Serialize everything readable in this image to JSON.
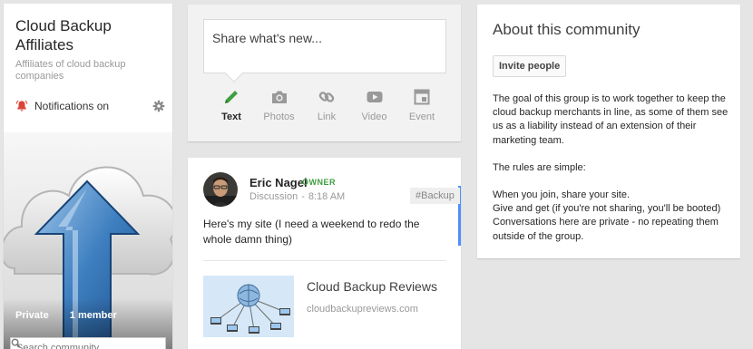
{
  "community": {
    "title": "Cloud Backup Affiliates",
    "subtitle": "Affiliates of cloud backup companies",
    "notifications_label": "Notifications on",
    "privacy": "Private",
    "members": "1 member",
    "search_placeholder": "Search community",
    "icons": {
      "notifications": "bell-icon",
      "settings": "gear-icon",
      "search": "search-icon"
    },
    "bell_color": "#db4437"
  },
  "share": {
    "placeholder": "Share what's new...",
    "actions": [
      {
        "label": "Text",
        "icon": "pencil-icon",
        "active": true
      },
      {
        "label": "Photos",
        "icon": "camera-icon",
        "active": false
      },
      {
        "label": "Link",
        "icon": "link-icon",
        "active": false
      },
      {
        "label": "Video",
        "icon": "video-icon",
        "active": false
      },
      {
        "label": "Event",
        "icon": "calendar-icon",
        "active": false
      }
    ],
    "active_color": "#3f9f3f"
  },
  "post": {
    "author": "Eric Nagel",
    "badge": "OWNER",
    "category": "Discussion",
    "separator": "-",
    "time": "8:18 AM",
    "tag": "#Backup",
    "text": "Here's my site (I need a weekend to redo the whole damn thing)",
    "link": {
      "title": "Cloud Backup Reviews",
      "url": "cloudbackupreviews.com"
    }
  },
  "about": {
    "title": "About this community",
    "invite_label": "Invite people",
    "description": "The goal of this group is to work together to keep the cloud backup merchants in line, as some of them see us as a liability instead of an extension of their marketing team.",
    "rules_intro": "The rules are simple:",
    "rules": [
      "When you join, share your site.",
      "Give and get (if you're not sharing, you'll be booted)",
      "Conversations here are private - no repeating them outside of the group."
    ]
  },
  "colors": {
    "accent_blue": "#4d90fe",
    "owner_green": "#3f9f3f",
    "background": "#e5e5e5"
  }
}
